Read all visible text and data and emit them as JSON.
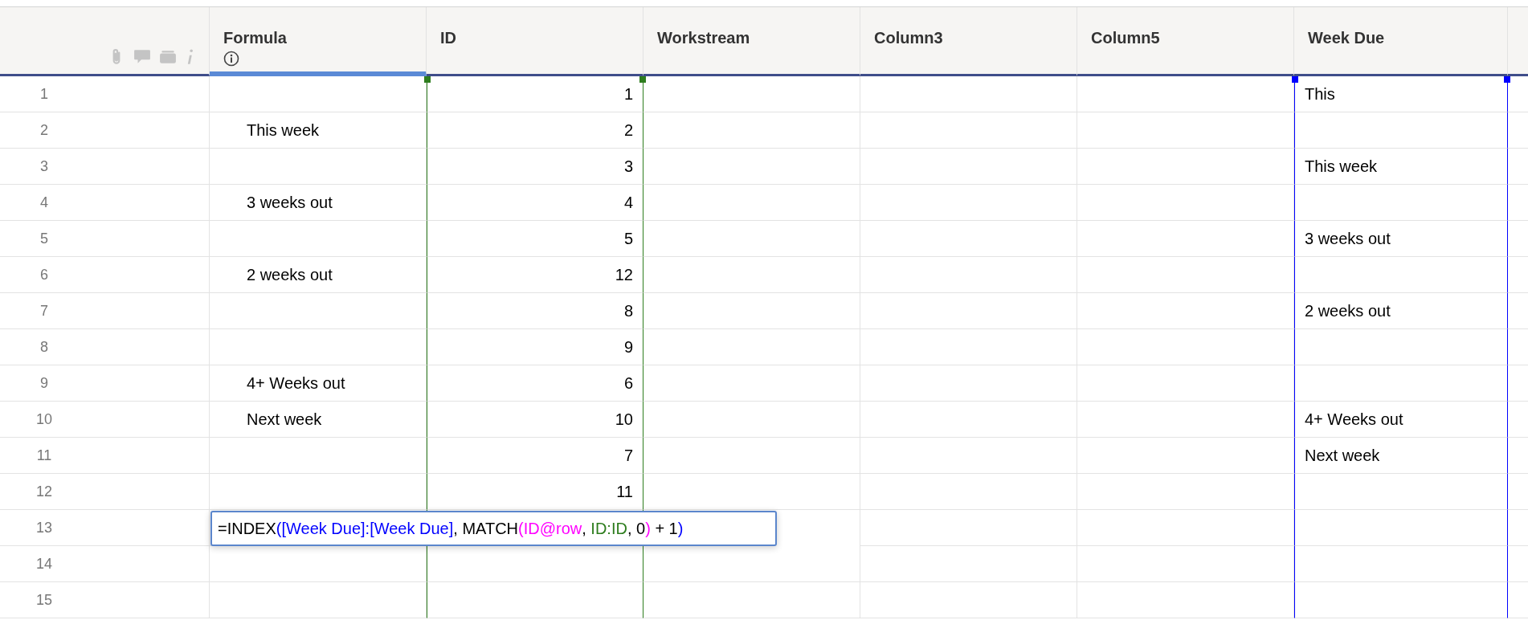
{
  "columns": [
    {
      "name": "Formula",
      "editing": true,
      "info": true
    },
    {
      "name": "ID",
      "editing": false,
      "color": "#2e7d1e"
    },
    {
      "name": "Workstream",
      "editing": false
    },
    {
      "name": "Column3",
      "editing": false
    },
    {
      "name": "Column5",
      "editing": false
    },
    {
      "name": "Week Due",
      "editing": false,
      "color": "#0000ff"
    }
  ],
  "rows": [
    {
      "number": "1",
      "id": "1",
      "week_due": "This"
    },
    {
      "number": "2",
      "formula": "This week",
      "id": "2"
    },
    {
      "number": "3",
      "id": "3",
      "week_due": "This week"
    },
    {
      "number": "4",
      "formula": "3 weeks out",
      "id": "4"
    },
    {
      "number": "5",
      "id": "5",
      "week_due": "3 weeks out"
    },
    {
      "number": "6",
      "formula": "2 weeks out",
      "id": "12"
    },
    {
      "number": "7",
      "id": "8",
      "week_due": "2 weeks out"
    },
    {
      "number": "8",
      "id": "9"
    },
    {
      "number": "9",
      "formula": "4+ Weeks out",
      "id": "6"
    },
    {
      "number": "10",
      "formula": "Next week",
      "id": "10",
      "week_due": "4+ Weeks out"
    },
    {
      "number": "11",
      "id": "7",
      "week_due": "Next week"
    },
    {
      "number": "12",
      "id": "11"
    },
    {
      "number": "13"
    },
    {
      "number": "14"
    },
    {
      "number": "15"
    }
  ],
  "formula_editor": {
    "tokens": [
      {
        "text": "=INDEX",
        "color": "#000000"
      },
      {
        "text": "([Week Due]:[Week Due]",
        "color": "#0000ff"
      },
      {
        "text": ", MATCH",
        "color": "#000000"
      },
      {
        "text": "(ID@row",
        "color": "#ff00ff"
      },
      {
        "text": ", ",
        "color": "#000000"
      },
      {
        "text": "ID:ID",
        "color": "#2e7d1e"
      },
      {
        "text": ", 0",
        "color": "#000000"
      },
      {
        "text": ")",
        "color": "#ff00ff"
      },
      {
        "text": " + 1",
        "color": "#000000"
      },
      {
        "text": ")",
        "color": "#0000ff"
      }
    ]
  }
}
